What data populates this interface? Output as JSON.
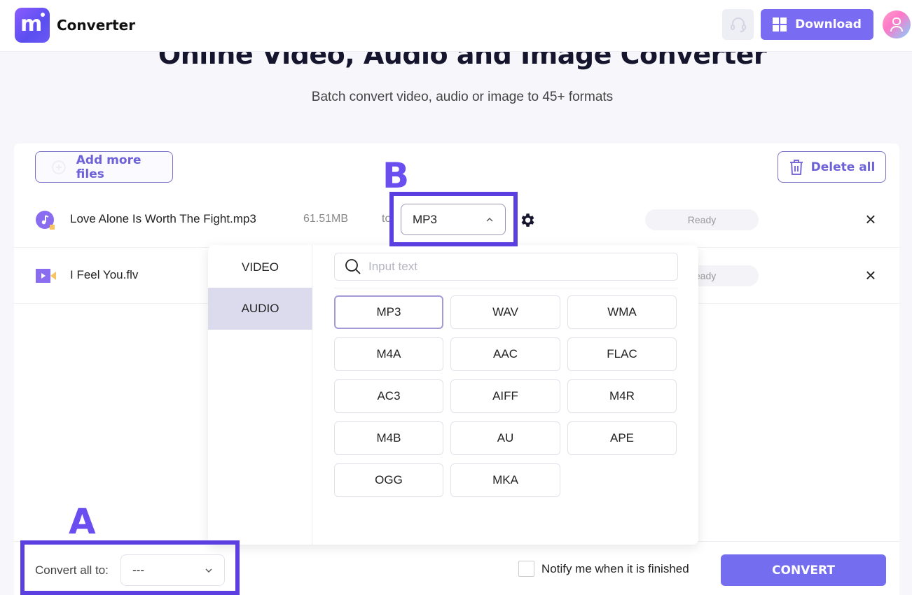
{
  "header": {
    "brand_name": "Converter",
    "logo_glyph": "m",
    "download_label": "Download",
    "support_icon": "headset-icon",
    "download_icon": "windows-icon",
    "avatar_icon": "user-icon"
  },
  "hero": {
    "title": "Online Video, Audio and Image Converter",
    "subtitle": "Batch convert video, audio or image to 45+ formats"
  },
  "toolbar": {
    "add_label": "Add more files",
    "delete_label": "Delete all"
  },
  "files": [
    {
      "name": "Love Alone Is Worth The Fight.mp3",
      "size": "61.51MB",
      "to_label": "to",
      "format": "MP3",
      "status": "Ready",
      "type": "audio"
    },
    {
      "name": "I Feel You.flv",
      "status": "Ready",
      "type": "video"
    }
  ],
  "dropdown": {
    "tabs": [
      "VIDEO",
      "AUDIO"
    ],
    "active_tab": "AUDIO",
    "search_placeholder": "Input text",
    "formats": [
      "MP3",
      "WAV",
      "WMA",
      "M4A",
      "AAC",
      "FLAC",
      "AC3",
      "AIFF",
      "M4R",
      "M4B",
      "AU",
      "APE",
      "OGG",
      "MKA"
    ],
    "selected": "MP3"
  },
  "annotations": {
    "a": "A",
    "b": "B"
  },
  "bottom": {
    "convert_all_label": "Convert all to:",
    "convert_all_value": "---",
    "notify_label": "Notify me when it is finished",
    "notify_checked": false,
    "convert_label": "CONVERT"
  },
  "colors": {
    "accent": "#756df0",
    "annotation": "#5b3fe0",
    "selected_tab": "#dcdbee"
  }
}
